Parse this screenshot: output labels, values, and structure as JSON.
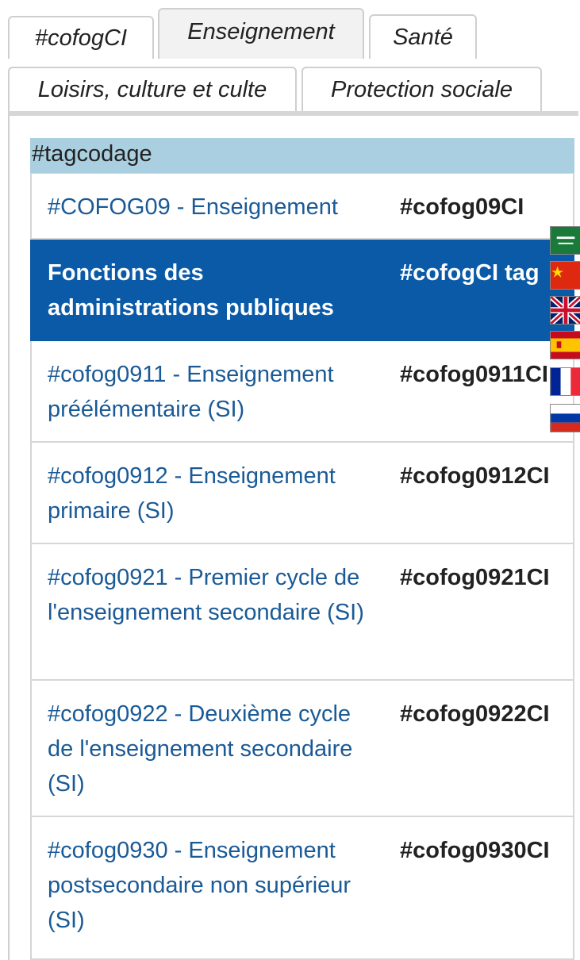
{
  "tabs": [
    {
      "label": "#cofogCI",
      "active": false
    },
    {
      "label": "Enseignement",
      "active": true
    },
    {
      "label": "Santé",
      "active": false
    },
    {
      "label": "Loisirs, culture et culte",
      "active": false
    },
    {
      "label": "Protection sociale",
      "active": false
    }
  ],
  "table": {
    "header": "#tagcodage",
    "rows": [
      {
        "label": "#COFOG09 - Enseignement",
        "code": "#cofog09CI",
        "selected": false
      },
      {
        "label": "Fonctions des administrations publiques",
        "code": "#cofogCI tag",
        "selected": true
      },
      {
        "label": "#cofog0911 - Enseignement préélémentaire (SI)",
        "code": "#cofog0911CI",
        "selected": false
      },
      {
        "label": "#cofog0912 - Enseignement primaire (SI)",
        "code": "#cofog0912CI",
        "selected": false
      },
      {
        "label": "#cofog0921 - Premier cycle de l'enseignement secondaire (SI)",
        "code": "#cofog0921CI",
        "selected": false
      },
      {
        "label": "#cofog0922 - Deuxième cycle de l'enseignement secondaire (SI)",
        "code": "#cofog0922CI",
        "selected": false
      },
      {
        "label": "#cofog0930 - Enseignement postsecondaire non supérieur (SI)",
        "code": "#cofog0930CI",
        "selected": false
      }
    ]
  },
  "language_flags": [
    {
      "icon": "saudi-arabia-flag-icon"
    },
    {
      "icon": "china-flag-icon"
    },
    {
      "icon": "uk-flag-icon"
    },
    {
      "icon": "spain-flag-icon"
    },
    {
      "icon": "france-flag-icon"
    },
    {
      "icon": "russia-flag-icon"
    }
  ],
  "colors": {
    "accent": "#0a5aa8",
    "link": "#1a5a96",
    "header_bg": "#a9cfe0"
  }
}
